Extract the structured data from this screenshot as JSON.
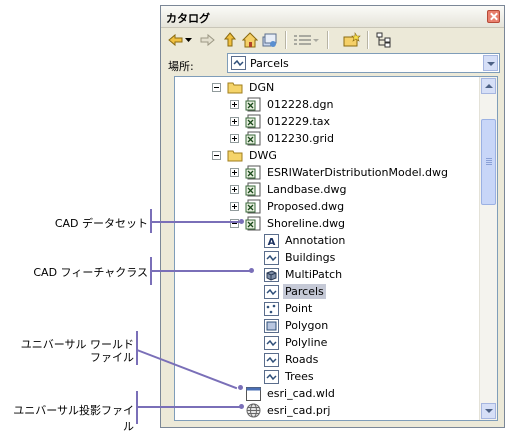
{
  "window": {
    "title": "カタログ",
    "location_label": "場所:",
    "location_value": "Parcels"
  },
  "toolbar": {
    "icons": [
      "back-arrow-icon",
      "dropdown-arrow-icon",
      "forward-arrow-icon",
      "up-level-icon",
      "home-icon",
      "connect-folder-icon",
      "view-options-icon",
      "new-item-icon",
      "tree-options-icon"
    ]
  },
  "tree": {
    "dgn": "DGN",
    "dgn_items": [
      "012228.dgn",
      "012229.tax",
      "012230.grid"
    ],
    "dwg": "DWG",
    "dwg_items": [
      "ESRIWaterDistributionModel.dwg",
      "Landbase.dwg",
      "Proposed.dwg"
    ],
    "shoreline": "Shoreline.dwg",
    "classes": [
      "Annotation",
      "Buildings",
      "MultiPatch",
      "Parcels",
      "Point",
      "Polygon",
      "Polyline",
      "Roads",
      "Trees"
    ],
    "wld": "esri_cad.wld",
    "prj": "esri_cad.prj"
  },
  "callouts": {
    "cad_dataset": "CAD データセット",
    "cad_feature_class": "CAD フィーチャクラス",
    "world_file_line1": "ユニバーサル ワールド",
    "world_file_line2": "ファイル",
    "projection_file": "ユニバーサル投影ファイル"
  },
  "colors": {
    "accent_line": "#7a6fb8",
    "selection": "#c5c9d6",
    "window_bg": "#ece9d8"
  }
}
